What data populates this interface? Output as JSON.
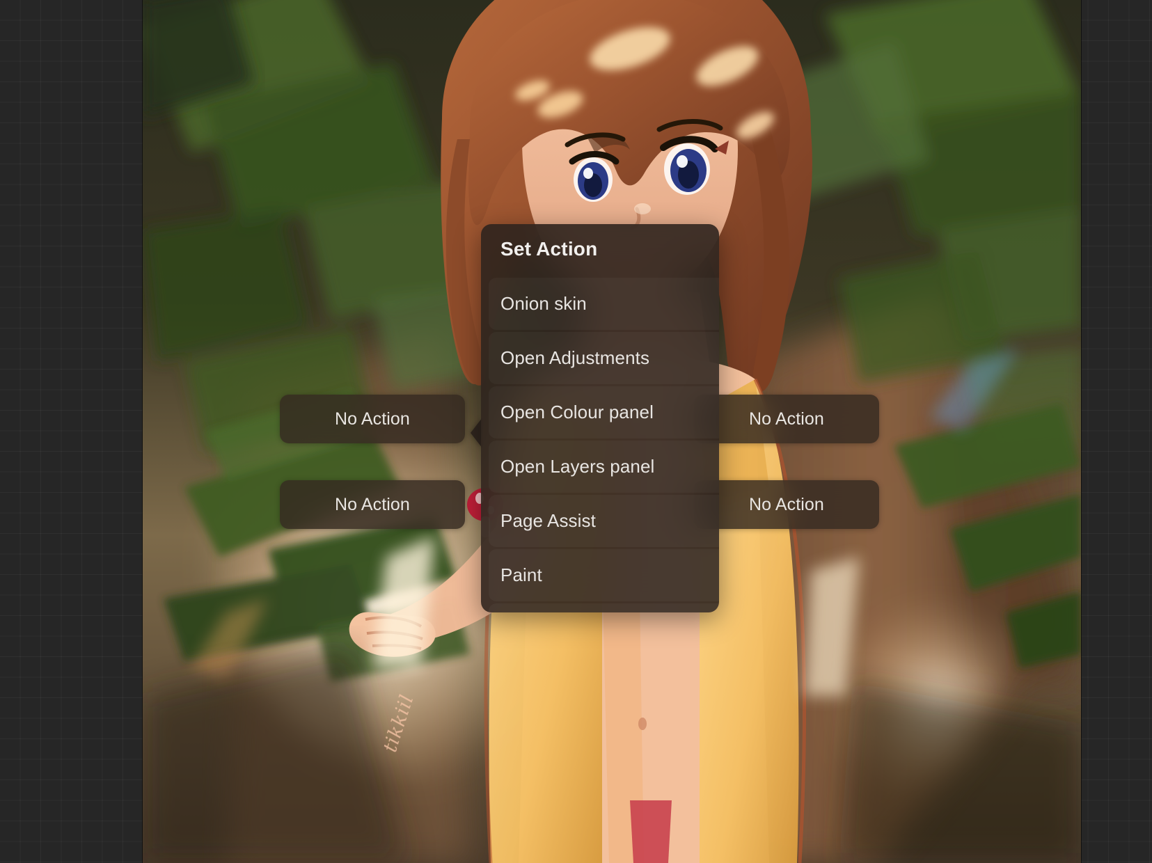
{
  "app": {
    "canvas_background": "#262626",
    "artwork_description": "Anime illustration of a girl with auburn short hair and blue eyes standing under dappled sunlight through green leaves",
    "signature": "tikkiil"
  },
  "quick_menu": {
    "buttons": [
      {
        "label": "No Action",
        "position": "top-left"
      },
      {
        "label": "No Action",
        "position": "top-right"
      },
      {
        "label": "No Action",
        "position": "bottom-left"
      },
      {
        "label": "No Action",
        "position": "bottom-right"
      }
    ]
  },
  "popover": {
    "title": "Set Action",
    "items": [
      {
        "label": "Onion skin"
      },
      {
        "label": "Open Adjustments"
      },
      {
        "label": "Open Colour panel"
      },
      {
        "label": "Open Layers panel"
      },
      {
        "label": "Page Assist"
      },
      {
        "label": "Paint"
      },
      {
        "label": ""
      }
    ],
    "accent": "#2e241e",
    "text_color": "#e8e5e2"
  }
}
